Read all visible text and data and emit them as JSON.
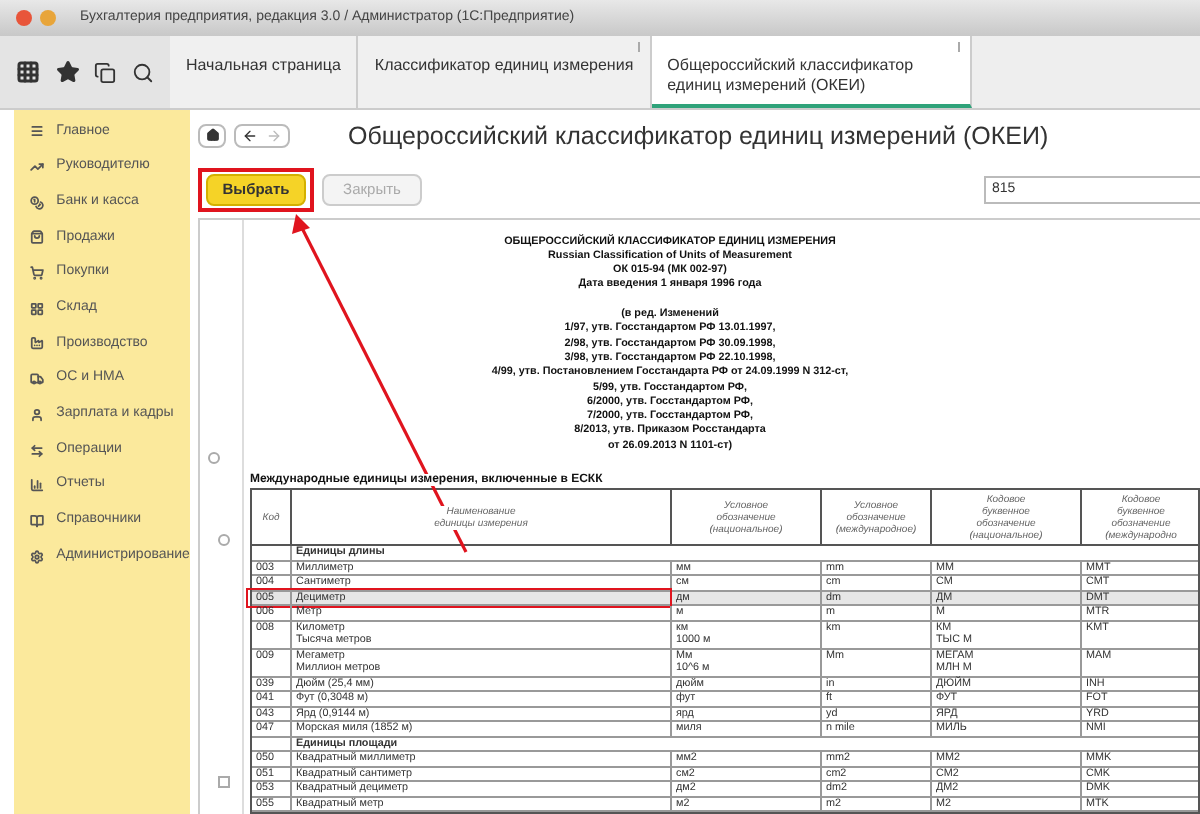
{
  "window": {
    "title": "Бухгалтерия предприятия, редакция 3.0 / Администратор  (1С:Предприятие)"
  },
  "tabs": [
    {
      "label": "Начальная страница",
      "closable": false,
      "selected": false
    },
    {
      "label": "Классификатор единиц измерения",
      "closable": true,
      "selected": false
    },
    {
      "label": "Общероссийский классификатор единиц измерений (ОКЕИ)",
      "closable": true,
      "selected": true
    }
  ],
  "sidebar": {
    "items": [
      {
        "label": "Главное"
      },
      {
        "label": "Руководителю"
      },
      {
        "label": "Банк и касса"
      },
      {
        "label": "Продажи"
      },
      {
        "label": "Покупки"
      },
      {
        "label": "Склад"
      },
      {
        "label": "Производство"
      },
      {
        "label": "ОС и НМА"
      },
      {
        "label": "Зарплата и кадры"
      },
      {
        "label": "Операции"
      },
      {
        "label": "Отчеты"
      },
      {
        "label": "Справочники"
      },
      {
        "label": "Администрирование"
      }
    ]
  },
  "form": {
    "title": "Общероссийский классификатор единиц измерений (ОКЕИ)",
    "buttons": [
      {
        "label": "Выбрать",
        "kind": "primary",
        "disabled": false
      },
      {
        "label": "Закрыть",
        "kind": "normal",
        "disabled": true
      }
    ],
    "search": {
      "value": "815"
    }
  },
  "document": {
    "header_lines": [
      "ОБЩЕРОССИЙСКИЙ КЛАССИФИКАТОР ЕДИНИЦ ИЗМЕРЕНИЯ",
      "Russian Classification of Units of Measurement",
      "ОК 015-94 (МК 002-97)",
      "Дата введения 1 января 1996 года"
    ],
    "amendment_lines": [
      "(в ред. Изменений",
      "1/97, утв. Госстандартом РФ 13.01.1997,",
      "2/98, утв. Госстандартом РФ 30.09.1998,",
      "3/98, утв. Госстандартом РФ 22.10.1998,",
      "4/99, утв. Постановлением Госстандарта РФ от 24.09.1999 N 312-ст,",
      "5/99, утв. Госстандартом РФ,",
      "6/2000, утв. Госстандартом РФ,",
      "7/2000, утв. Госстандартом РФ,",
      "8/2013, утв. Приказом Росстандарта",
      "от 26.09.2013 N 1101-ст)"
    ],
    "section_title": "Международные единицы измерения, включенные в ЕСКК",
    "table": {
      "columns": [
        "Код",
        "Наименование\nединицы измерения",
        "Условное\nобозначение\n(национальное)",
        "Условное\nобозначение\n(международное)",
        "Кодовое\nбуквенное\nобозначение\n(национальное)",
        "Кодовое\nбуквенное\nобозначение\n(международно"
      ],
      "rows": [
        {
          "kind": "group",
          "label": "Единицы длины"
        },
        {
          "kind": "row",
          "selected": false,
          "cells": [
            "003",
            "Миллиметр",
            "мм",
            "mm",
            "ММ",
            "MMT"
          ]
        },
        {
          "kind": "row",
          "selected": false,
          "cells": [
            "004",
            "Сантиметр",
            "см",
            "cm",
            "СМ",
            "CMT"
          ]
        },
        {
          "kind": "row",
          "selected": true,
          "cells": [
            "005",
            "Дециметр",
            "дм",
            "dm",
            "ДМ",
            "DMT"
          ]
        },
        {
          "kind": "row",
          "selected": false,
          "cells": [
            "006",
            "Метр",
            "м",
            "m",
            "М",
            "MTR"
          ]
        },
        {
          "kind": "row",
          "selected": false,
          "cells": [
            "008",
            "Километр\nТысяча метров",
            "км\n1000 м",
            "km",
            "КМ\nТЫС М",
            "KMT"
          ]
        },
        {
          "kind": "row",
          "selected": false,
          "cells": [
            "009",
            "Мегаметр\nМиллион метров",
            "Мм\n10^6 м",
            "Mm",
            "МЕГАМ\nМЛН М",
            "MAM"
          ]
        },
        {
          "kind": "row",
          "selected": false,
          "cells": [
            "039",
            "Дюйм (25,4 мм)",
            "дюйм",
            "in",
            "ДЮЙМ",
            "INH"
          ]
        },
        {
          "kind": "row",
          "selected": false,
          "cells": [
            "041",
            "Фут (0,3048 м)",
            "фут",
            "ft",
            "ФУТ",
            "FOT"
          ]
        },
        {
          "kind": "row",
          "selected": false,
          "cells": [
            "043",
            "Ярд (0,9144 м)",
            "ярд",
            "yd",
            "ЯРД",
            "YRD"
          ]
        },
        {
          "kind": "row",
          "selected": false,
          "cells": [
            "047",
            "Морская миля (1852 м)",
            "миля",
            "n mile",
            "МИЛЬ",
            "NMI"
          ]
        },
        {
          "kind": "group",
          "label": "Единицы площади"
        },
        {
          "kind": "row",
          "selected": false,
          "cells": [
            "050",
            "Квадратный миллиметр",
            "мм2",
            "mm2",
            "ММ2",
            "MMK"
          ]
        },
        {
          "kind": "row",
          "selected": false,
          "cells": [
            "051",
            "Квадратный сантиметр",
            "см2",
            "cm2",
            "СМ2",
            "CMK"
          ]
        },
        {
          "kind": "row",
          "selected": false,
          "cells": [
            "053",
            "Квадратный дециметр",
            "дм2",
            "dm2",
            "ДМ2",
            "DMK"
          ]
        },
        {
          "kind": "row",
          "selected": false,
          "cells": [
            "055",
            "Квадратный метр",
            "м2",
            "m2",
            "М2",
            "MTK"
          ]
        }
      ]
    }
  }
}
